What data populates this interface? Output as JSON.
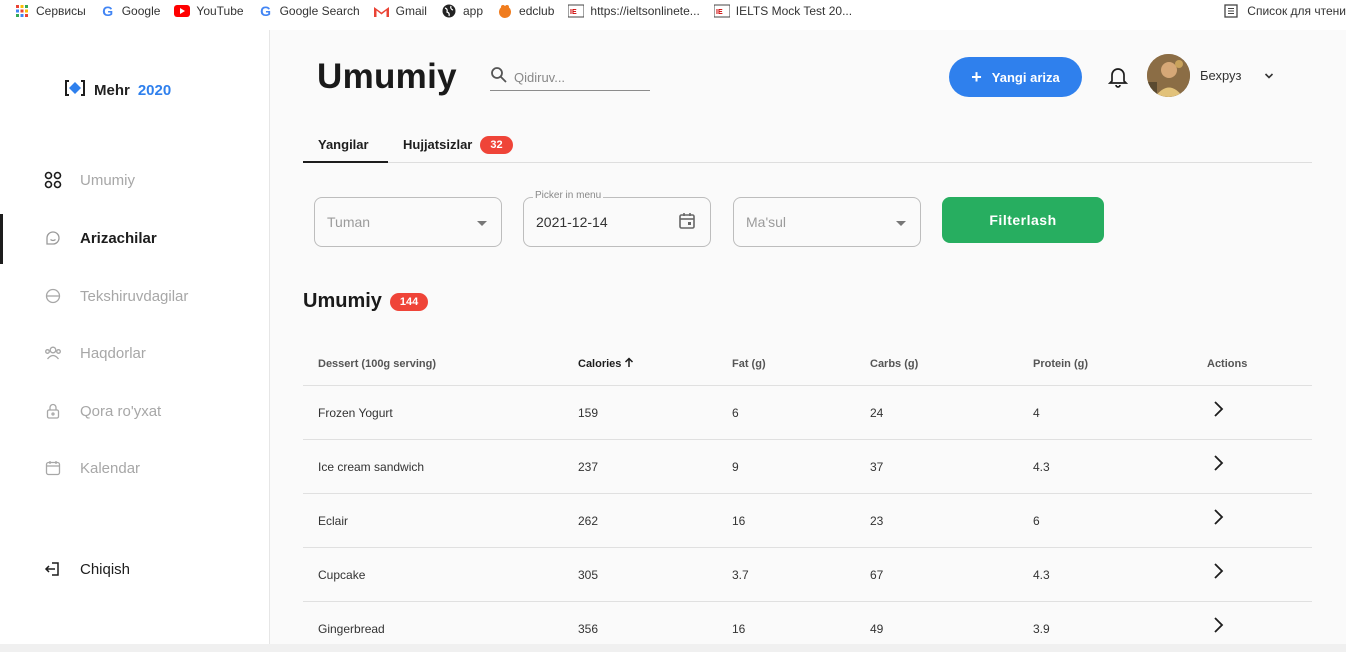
{
  "bookmarks": {
    "items": [
      {
        "label": "Сервисы",
        "icon": "apps-grid-icon"
      },
      {
        "label": "Google",
        "icon": "google-icon"
      },
      {
        "label": "YouTube",
        "icon": "youtube-icon"
      },
      {
        "label": "Google Search",
        "icon": "google-icon"
      },
      {
        "label": "Gmail",
        "icon": "gmail-icon"
      },
      {
        "label": "app",
        "icon": "globe-icon"
      },
      {
        "label": "edclub",
        "icon": "edclub-icon"
      },
      {
        "label": "https://ieltsonlinete...",
        "icon": "ielts-icon"
      },
      {
        "label": "IELTS Mock Test 20...",
        "icon": "ielts-icon"
      }
    ],
    "reading_list": "Список для чтени"
  },
  "sidebar": {
    "logo_name": "Mehr",
    "logo_year": "2020",
    "items": [
      {
        "label": "Umumiy",
        "icon": "grid-icon",
        "active": false
      },
      {
        "label": "Arizachilar",
        "icon": "smile-icon",
        "active": true
      },
      {
        "label": "Tekshiruvdagilar",
        "icon": "globe-icon",
        "active": false
      },
      {
        "label": "Haqdorlar",
        "icon": "users-icon",
        "active": false
      },
      {
        "label": "Qora ro'yxat",
        "icon": "lock-icon",
        "active": false
      },
      {
        "label": "Kalendar",
        "icon": "calendar-icon",
        "active": false
      }
    ],
    "logout": "Chiqish"
  },
  "header": {
    "title": "Umumiy",
    "search_placeholder": "Qidiruv...",
    "new_button": "Yangi ariza",
    "user_name": "Бехруз"
  },
  "tabs": [
    {
      "label": "Yangilar",
      "active": true
    },
    {
      "label": "Hujjatsizlar",
      "badge": "32"
    }
  ],
  "filters": {
    "district_placeholder": "Tuman",
    "date_legend": "Picker in menu",
    "date_value": "2021-12-14",
    "responsible_placeholder": "Ma'sul",
    "filter_button": "Filterlash"
  },
  "section": {
    "title": "Umumiy",
    "count": "144"
  },
  "table": {
    "columns": [
      "Dessert (100g serving)",
      "Calories",
      "Fat (g)",
      "Carbs (g)",
      "Protein (g)",
      "Actions"
    ],
    "rows": [
      [
        "Frozen Yogurt",
        "159",
        "6",
        "24",
        "4"
      ],
      [
        "Ice cream sandwich",
        "237",
        "9",
        "37",
        "4.3"
      ],
      [
        "Eclair",
        "262",
        "16",
        "23",
        "6"
      ],
      [
        "Cupcake",
        "305",
        "3.7",
        "67",
        "4.3"
      ],
      [
        "Gingerbread",
        "356",
        "16",
        "49",
        "3.9"
      ]
    ]
  },
  "colors": {
    "accent": "#2f80ed",
    "success": "#27ae60",
    "badge": "#ef4438"
  }
}
